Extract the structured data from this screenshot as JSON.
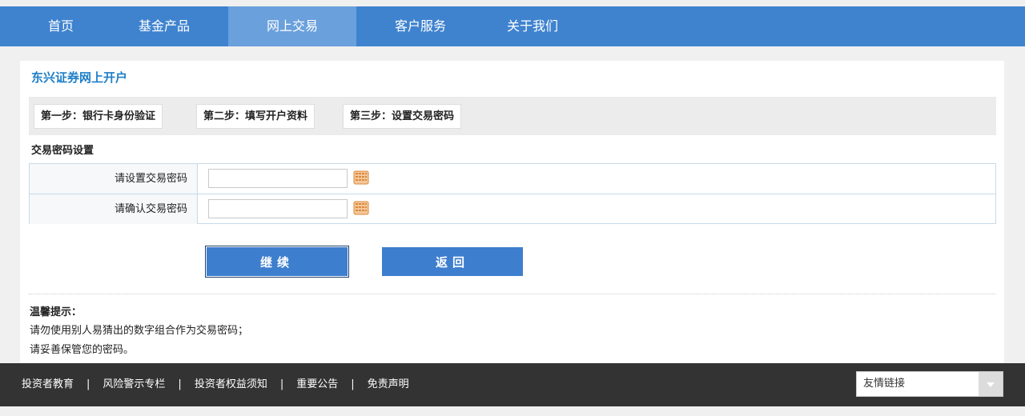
{
  "nav": {
    "items": [
      {
        "label": "首页",
        "width": 98,
        "active": false
      },
      {
        "label": "基金产品",
        "width": 160,
        "active": false
      },
      {
        "label": "网上交易",
        "width": 160,
        "active": true
      },
      {
        "label": "客户服务",
        "width": 160,
        "active": false
      },
      {
        "label": "关于我们",
        "width": 120,
        "active": false
      }
    ]
  },
  "page": {
    "title": "东兴证券网上开户",
    "steps": [
      "第一步：银行卡身份验证",
      "第二步：填写开户资料",
      "第三步：设置交易密码"
    ],
    "section_title": "交易密码设置"
  },
  "form": {
    "set_password_label": "请设置交易密码",
    "set_password_value": "",
    "confirm_password_label": "请确认交易密码",
    "confirm_password_value": "",
    "keyboard_icon": "keyboard-icon"
  },
  "buttons": {
    "continue": "继续",
    "back": "返回"
  },
  "tips": {
    "title": "温馨提示：",
    "lines": [
      "请勿使用别人易猜出的数字组合作为交易密码；",
      "请妥善保管您的密码。"
    ]
  },
  "footer": {
    "links": [
      "投资者教育",
      "风险警示专栏",
      "投资者权益须知",
      "重要公告",
      "免责声明"
    ],
    "separator": "|",
    "friend_links": "友情链接"
  },
  "colors": {
    "nav_bg": "#3f83cf",
    "nav_active": "#6aa0dc",
    "title": "#1e7ec8",
    "button": "#3e7ece",
    "footer_bg": "#333333"
  }
}
